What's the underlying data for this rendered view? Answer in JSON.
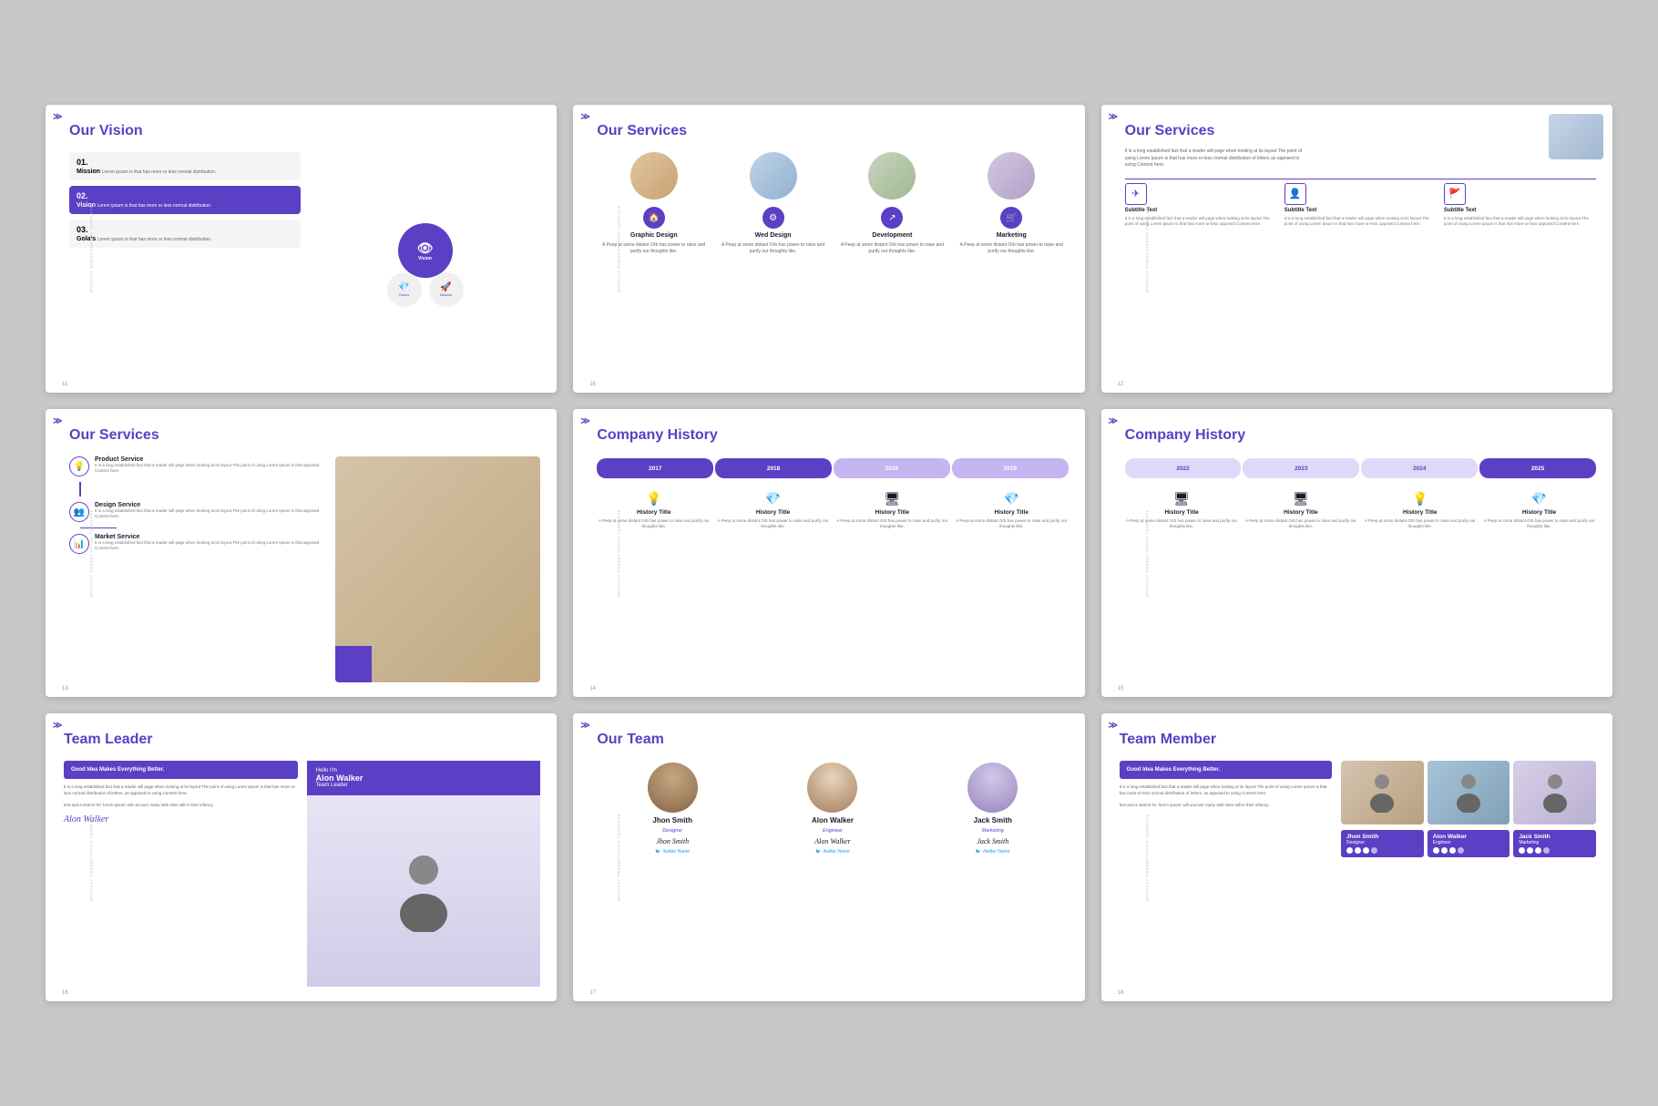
{
  "slides": [
    {
      "id": "slide1",
      "title_plain": "Our ",
      "title_purple": "Vision",
      "label": "Monthly Presentation Template",
      "num": "11",
      "items": [
        {
          "num": "01.",
          "title": "Mission",
          "text": "Lorem ipsum is that has more or less normal distribution."
        },
        {
          "num": "02.",
          "title": "Vision",
          "text": "Lorem ipsum is that has more or less normal distribution.",
          "active": true
        },
        {
          "num": "03.",
          "title": "Gola's",
          "text": "Lorem ipsum is that has more or less normal distribution."
        }
      ],
      "circles": [
        "Vision",
        "Gola's",
        "Mission"
      ]
    },
    {
      "id": "slide2",
      "title_plain": "Our ",
      "title_purple": "Services",
      "label": "Monthly Presentation Template",
      "num": "16",
      "services": [
        {
          "title": "Graphic Design",
          "text": "A Peep at some distant Orb has power to raise and purify our thoughts like."
        },
        {
          "title": "Wed Design",
          "text": "A Peep at some distant Orb has power to raise and purify our thoughts like."
        },
        {
          "title": "Development",
          "text": "A Peep at some distant Orb has power to raise and purify our thoughts like."
        },
        {
          "title": "Marketing",
          "text": "A Peep at some distant Orb has power to raise and purify our thoughts like."
        }
      ]
    },
    {
      "id": "slide3",
      "title_plain": "Our ",
      "title_purple": "Services",
      "label": "Monthly Presentation Template",
      "num": "12",
      "intro": "It is a long established fact that a reader will page when looking at its layout The point of using Lorem Ipsum is that has more-or-less normal distribution of letters as opposed to using Content here.",
      "icons": [
        {
          "title": "Subtitle Text",
          "text": "It is a long established fact that a reader will page when looking at its layout The point of using Lorem Ipsum is that has more-or-less opposed Content here."
        },
        {
          "title": "Subtitle Text",
          "text": "It is a long established fact that a reader will page when looking at its layout The point of using Lorem Ipsum is that has more-or-less opposed Content here."
        },
        {
          "title": "Subtitle Text",
          "text": "It is a long established fact that a reader will page when looking at its layout The point of using Lorem Ipsum is that has more-or-less opposed Content here."
        }
      ]
    },
    {
      "id": "slide4",
      "title_plain": "Our ",
      "title_purple": "Services",
      "label": "Monthly Presentation Template",
      "num": "13",
      "services": [
        {
          "title": "Product Service",
          "text": "It is a long established fact that a reader will page when looking at its layout The point of using Lorem Ipsum is that apposed Content here."
        },
        {
          "title": "Design Service",
          "text": "It is a long established fact that a reader will page when looking at its layout The point of using Lorem Ipsum is that apposed Content here."
        },
        {
          "title": "Market Service",
          "text": "It is a long established fact that a reader will page when looking at its layout The point of using Lorem Ipsum is that apposed Content here."
        }
      ]
    },
    {
      "id": "slide5",
      "title_plain": "Company ",
      "title_purple": "History",
      "label": "Monthly Presentation Template",
      "num": "14",
      "years": [
        "2017",
        "2018",
        "2018",
        "2019"
      ],
      "history": [
        {
          "title": "History Title",
          "text": "A Peep at some distant Orb has power to raise and purify our thoughts like."
        },
        {
          "title": "History Title",
          "text": "A Peep at some distant Orb has power to raise and purify our thoughts like."
        },
        {
          "title": "History Title",
          "text": "A Peep at some distant Orb has power to raise and purify our thoughts like."
        },
        {
          "title": "History Title",
          "text": "A Peep at some distant Orb has power to raise and purify our thoughts like."
        }
      ]
    },
    {
      "id": "slide6",
      "title_plain": "Company ",
      "title_purple": "History",
      "label": "Monthly Presentation Template",
      "num": "15",
      "years": [
        "2022",
        "2023",
        "2024",
        "2025"
      ],
      "active_year": "2025",
      "history": [
        {
          "title": "History Title",
          "text": "A Peep at some distant Orb has power to raise and purify our thoughts like."
        },
        {
          "title": "History Title",
          "text": "A Peep at some distant Orb has power to raise and purify our thoughts like."
        },
        {
          "title": "History Title",
          "text": "A Peep at some distant Orb has power to raise and purify our thoughts like."
        },
        {
          "title": "History Title",
          "text": "A Peep at some distant Orb has power to raise and purify our thoughts like."
        }
      ]
    },
    {
      "id": "slide7",
      "title_plain": "Team ",
      "title_purple": "Leader",
      "label": "Monthly Presentation Template",
      "num": "16",
      "good_idea": "Good Idea Makes\nEverything Better.",
      "desc": "It is a long established fact that a reader will page when looking at its layout The point of using Lorem Ipsum is that has more-or-less normal distribution of letters, as apposed to using Content here.",
      "extra": "text and a search for 'lorem ipsum' will uncover many web sites still in their infancy.",
      "hello": "Hello I'm",
      "name": "Alon Walker",
      "role": "Team Leader",
      "sign": "Alon Walker"
    },
    {
      "id": "slide8",
      "title_plain": "Our ",
      "title_purple": "Team",
      "label": "Monthly Presentation Template",
      "num": "17",
      "members": [
        {
          "name": "Jhon Smith",
          "role": "Designer",
          "sign": "Jhon Smith",
          "twitter": "/twitter Name"
        },
        {
          "name": "Alon Walker",
          "role": "Engineer",
          "sign": "Alon Walker",
          "twitter": "/twitter Name"
        },
        {
          "name": "Jack Smith",
          "role": "Marketing",
          "sign": "Jack Smith",
          "twitter": "/twitter Name"
        }
      ]
    },
    {
      "id": "slide9",
      "title_plain": "Team ",
      "title_purple": "Member",
      "label": "Monthly Presentation Template",
      "num": "18",
      "good_idea": "Good Idea Makes\nEverything Better.",
      "desc": "It is a long established fact that a reader will page when looking at its layout The point of using Lorem Ipsum is that has more-or-less normal distribution of letters, as apposed to using Content here.",
      "extra": "text and a search for 'lorem ipsum' will uncover many web sites still in their infancy.",
      "members": [
        {
          "name": "Jhon Smith",
          "role": "Designer"
        },
        {
          "name": "Alon Walker",
          "role": "Engineer"
        },
        {
          "name": "Jack Smith",
          "role": "Marketing"
        }
      ]
    }
  ],
  "brand": {
    "purple": "#5B3FC4",
    "light_purple": "#c4b5f0",
    "dark": "#1a1a2e",
    "logo": "≫"
  }
}
